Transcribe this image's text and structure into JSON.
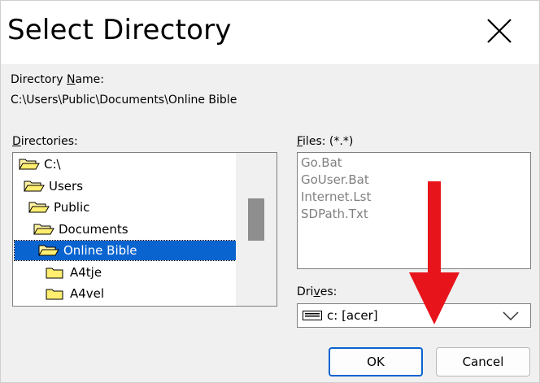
{
  "window": {
    "title": "Select Directory"
  },
  "directory_name": {
    "label_prefix": "Directory ",
    "label_accel": "N",
    "label_suffix": "ame:",
    "value": "C:\\Users\\Public\\Documents\\Online Bible"
  },
  "directories": {
    "label_accel": "D",
    "label_rest": "irectories:",
    "items": [
      {
        "label": "C:\\",
        "level": 0,
        "open": true,
        "selected": false
      },
      {
        "label": "Users",
        "level": 1,
        "open": true,
        "selected": false
      },
      {
        "label": "Public",
        "level": 2,
        "open": true,
        "selected": false
      },
      {
        "label": "Documents",
        "level": 3,
        "open": true,
        "selected": false
      },
      {
        "label": "Online Bible",
        "level": 4,
        "open": true,
        "selected": true
      },
      {
        "label": "A4tje",
        "level": 5,
        "open": false,
        "selected": false
      },
      {
        "label": "A4vel",
        "level": 5,
        "open": false,
        "selected": false
      }
    ]
  },
  "files": {
    "label_accel": "F",
    "label_rest": "iles: (*.*)",
    "items": [
      "Go.Bat",
      "GoUser.Bat",
      "Internet.Lst",
      "SDPath.Txt"
    ]
  },
  "drives": {
    "label_prefix": "Dri",
    "label_accel": "v",
    "label_suffix": "es:",
    "selected": "c: [acer]",
    "icon": "drive-icon"
  },
  "buttons": {
    "ok": "OK",
    "cancel": "Cancel"
  },
  "colors": {
    "selection": "#0a64d0",
    "annotation_arrow": "#e8141b"
  }
}
